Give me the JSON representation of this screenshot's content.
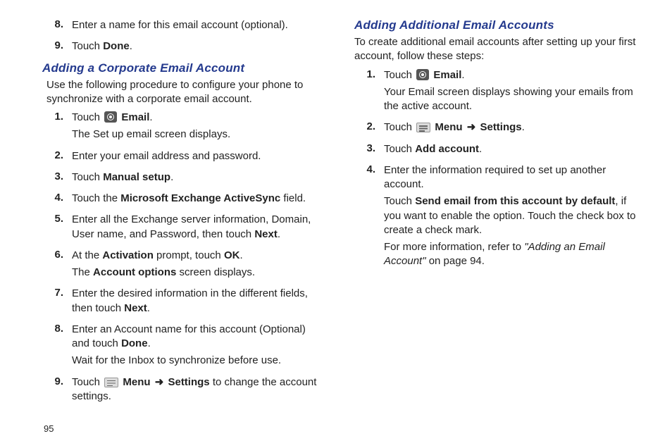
{
  "pageNumber": "95",
  "left": {
    "preSteps": [
      {
        "num": "8.",
        "lines": [
          "Enter a name for this email account (optional)."
        ]
      },
      {
        "num": "9.",
        "lines": [
          "Touch {b}Done{/b}."
        ]
      }
    ],
    "heading": "Adding a Corporate Email Account",
    "intro": "Use the following procedure to configure your phone to synchronize with a corporate email account.",
    "steps": [
      {
        "num": "1.",
        "lines": [
          "Touch {email-icon} {b}Email{/b}.",
          "The Set up email screen displays."
        ]
      },
      {
        "num": "2.",
        "lines": [
          "Enter your email address and password."
        ]
      },
      {
        "num": "3.",
        "lines": [
          "Touch {b}Manual setup{/b}."
        ]
      },
      {
        "num": "4.",
        "lines": [
          "Touch the {b}Microsoft Exchange ActiveSync{/b} field."
        ]
      },
      {
        "num": "5.",
        "lines": [
          "Enter all the Exchange server information, Domain, User name, and Password, then touch {b}Next{/b}."
        ]
      },
      {
        "num": "6.",
        "lines": [
          "At the {b}Activation{/b} prompt, touch {b}OK{/b}.",
          "The {b}Account options{/b} screen displays."
        ]
      },
      {
        "num": "7.",
        "lines": [
          "Enter the desired information in the different fields, then touch {b}Next{/b}."
        ]
      },
      {
        "num": "8.",
        "lines": [
          "Enter an Account name for this account (Optional) and touch {b}Done{/b}.",
          "Wait for the Inbox to synchronize before use."
        ]
      },
      {
        "num": "9.",
        "lines": [
          "Touch {menu-icon} {b}Menu{/b} {arrow} {b}Settings{/b} to change the account settings."
        ]
      }
    ]
  },
  "right": {
    "heading": "Adding Additional Email Accounts",
    "intro": "To create additional email accounts after setting up your first account, follow these steps:",
    "steps": [
      {
        "num": "1.",
        "lines": [
          "Touch {email-icon} {b}Email{/b}.",
          "Your Email screen displays showing your emails from the active account."
        ]
      },
      {
        "num": "2.",
        "lines": [
          "Touch {menu-icon} {b}Menu{/b} {arrow} {b}Settings{/b}."
        ]
      },
      {
        "num": "3.",
        "lines": [
          "Touch {b}Add account{/b}."
        ]
      },
      {
        "num": "4.",
        "lines": [
          "Enter the information required to set up another account.",
          "Touch {b}Send email from this account by default{/b}, if you want to enable the option. Touch the check box to create a check mark.",
          "For more information, refer to {i}\"Adding an Email Account\"{/i}  on page 94."
        ]
      }
    ]
  }
}
